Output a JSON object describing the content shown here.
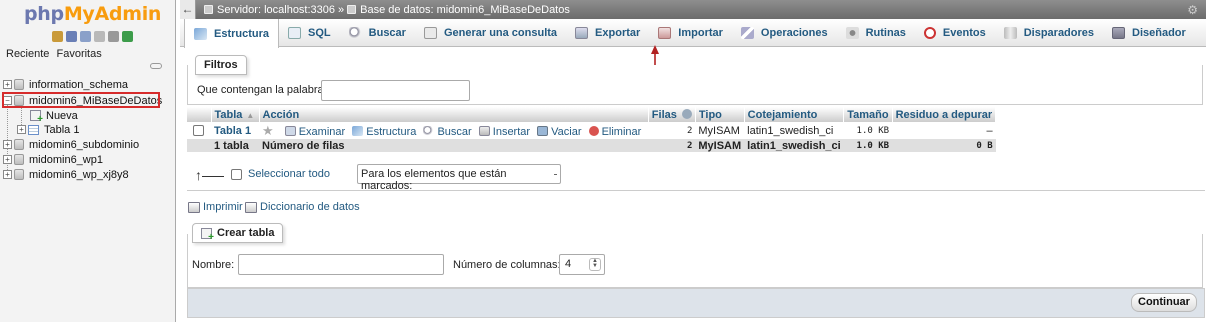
{
  "nav": {
    "logo_php": "php",
    "logo_myadmin": "MyAdmin",
    "tab_recent": "Reciente",
    "tab_favorites": "Favoritas",
    "tree": [
      {
        "label": "information_schema"
      },
      {
        "label": "midomin6_MiBaseDeDatos"
      },
      {
        "label": "Nueva"
      },
      {
        "label": "Tabla 1"
      },
      {
        "label": "midomin6_subdominio"
      },
      {
        "label": "midomin6_wp1"
      },
      {
        "label": "midomin6_wp_xj8y8"
      }
    ]
  },
  "breadcrumb": {
    "server": "Servidor: localhost:3306",
    "separator": "»",
    "database": "Base de datos: midomin6_MiBaseDeDatos"
  },
  "menu": {
    "tabs": [
      {
        "label": "Estructura",
        "icon": "structure-icon"
      },
      {
        "label": "SQL",
        "icon": "sql-icon"
      },
      {
        "label": "Buscar",
        "icon": "search-icon"
      },
      {
        "label": "Generar una consulta",
        "icon": "query-icon"
      },
      {
        "label": "Exportar",
        "icon": "export-icon"
      },
      {
        "label": "Importar",
        "icon": "import-icon"
      },
      {
        "label": "Operaciones",
        "icon": "wrench-icon"
      },
      {
        "label": "Rutinas",
        "icon": "routines-icon"
      },
      {
        "label": "Eventos",
        "icon": "clock-icon"
      },
      {
        "label": "Disparadores",
        "icon": "triggers-icon"
      },
      {
        "label": "Diseñador",
        "icon": "designer-icon"
      }
    ]
  },
  "filters": {
    "legend": "Filtros",
    "label": "Que contengan la palabra:",
    "value": ""
  },
  "table": {
    "headers": {
      "table": "Tabla",
      "action": "Acción",
      "rows": "Filas",
      "type": "Tipo",
      "collation": "Cotejamiento",
      "size": "Tamaño",
      "overhead": "Residuo a depurar"
    },
    "rows": [
      {
        "name": "Tabla 1",
        "actions": [
          "Examinar",
          "Estructura",
          "Buscar",
          "Insertar",
          "Vaciar",
          "Eliminar"
        ],
        "rows": "2",
        "type": "MyISAM",
        "collation": "latin1_swedish_ci",
        "size": "1.0 KB",
        "overhead": "–"
      }
    ],
    "summary": {
      "tables": "1 tabla",
      "label": "Número de filas",
      "rows": "2",
      "type": "MyISAM",
      "collation": "latin1_swedish_ci",
      "size": "1.0 KB",
      "overhead": "0 B"
    }
  },
  "bulk": {
    "check_all": "Seleccionar todo",
    "with_selected": "Para los elementos que están marcados:"
  },
  "links": {
    "print": "Imprimir",
    "dictionary": "Diccionario de datos"
  },
  "create": {
    "legend": "Crear tabla",
    "name_label": "Nombre:",
    "name_value": "",
    "cols_label": "Número de columnas:",
    "cols_value": "4",
    "continue": "Continuar"
  },
  "colors": {
    "link": "#235a81",
    "highlight": "#d62b2b",
    "annotation_arrow": "#b22222"
  }
}
